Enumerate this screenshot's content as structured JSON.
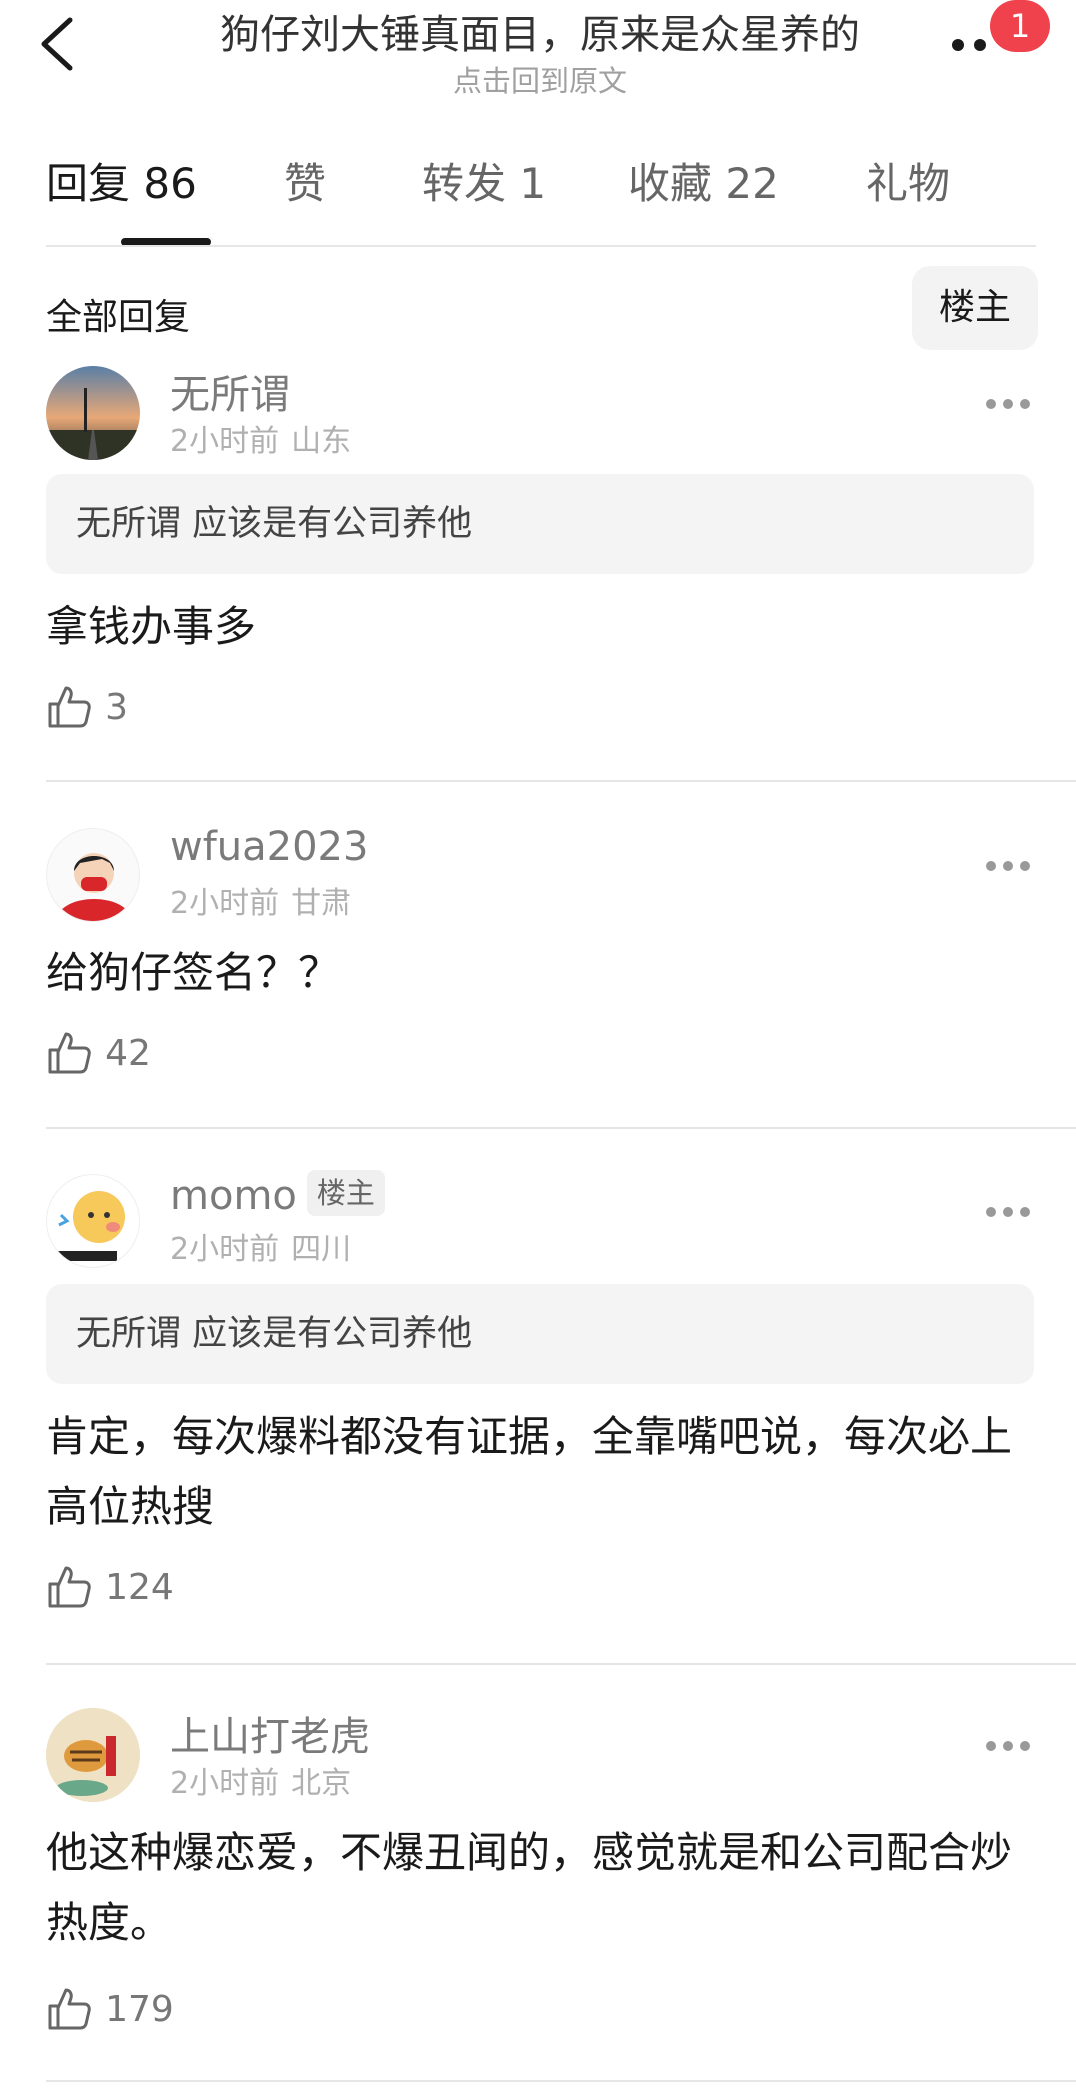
{
  "header": {
    "title": "狗仔刘大锤真面目，原来是众星养的",
    "subtitle": "点击回到原文",
    "badge_count": "1"
  },
  "tabs": [
    {
      "label": "回复",
      "count": "86"
    },
    {
      "label": "赞",
      "count": ""
    },
    {
      "label": "转发",
      "count": "1"
    },
    {
      "label": "收藏",
      "count": "22"
    },
    {
      "label": "礼物",
      "count": ""
    }
  ],
  "filter": {
    "all_label": "全部回复",
    "op_label": "楼主"
  },
  "comments": [
    {
      "username": "无所谓",
      "time": "2小时前",
      "location": "山东",
      "quote": "无所谓 应该是有公司养他",
      "text": "拿钱办事多",
      "likes": "3"
    },
    {
      "username": "wfua2023",
      "time": "2小时前",
      "location": "甘肃",
      "text": "给狗仔签名？？",
      "likes": "42"
    },
    {
      "username": "momo",
      "op_tag": "楼主",
      "time": "2小时前",
      "location": "四川",
      "quote": "无所谓 应该是有公司养他",
      "text": "肯定，每次爆料都没有证据，全靠嘴吧说，每次必上高位热搜",
      "likes": "124"
    },
    {
      "username": "上山打老虎",
      "time": "2小时前",
      "location": "北京",
      "text": "他这种爆恋爱，不爆丑闻的，感觉就是和公司配合炒热度。",
      "likes": "179"
    }
  ],
  "icons": [
    "back-arrow-icon",
    "more-dots-icon",
    "thumbs-up-icon"
  ],
  "colors": {
    "badge": "#f0424c",
    "muted": "#a0a0a0",
    "tag_bg": "#f0f0f0"
  }
}
